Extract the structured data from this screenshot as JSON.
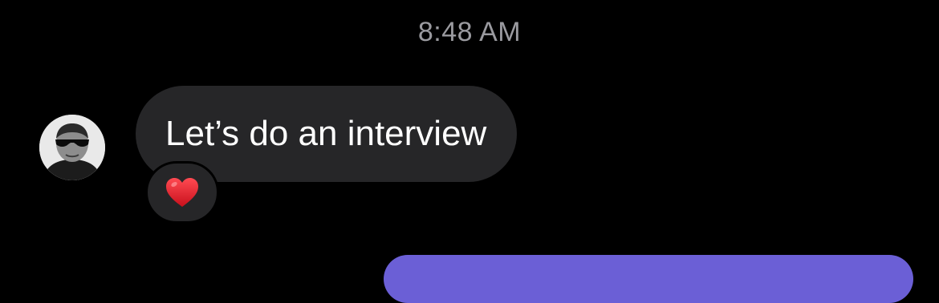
{
  "thread": {
    "timestamp": "8:48 AM",
    "messages": [
      {
        "direction": "incoming",
        "text": "Let’s do an interview",
        "reaction": "heart-emoji-icon"
      }
    ]
  },
  "colors": {
    "background": "#000000",
    "incoming_bubble": "#262628",
    "outgoing_bubble": "#6b5fd6",
    "timestamp_text": "#9a9a9f",
    "message_text": "#ffffff",
    "heart": "#e0202e"
  }
}
